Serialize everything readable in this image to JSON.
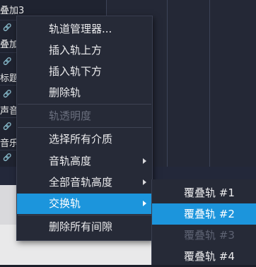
{
  "background": {
    "track_labels": [
      "叠加3",
      "叠加",
      "标题",
      "声音",
      "音乐"
    ]
  },
  "context_menu": {
    "items": [
      {
        "label": "轨道管理器...",
        "enabled": true
      },
      {
        "label": "插入轨上方",
        "enabled": true
      },
      {
        "label": "插入轨下方",
        "enabled": true
      },
      {
        "label": "删除轨",
        "enabled": true
      },
      {
        "label": "轨透明度",
        "enabled": false
      },
      {
        "label": "选择所有介质",
        "enabled": true
      },
      {
        "label": "音轨高度",
        "enabled": true,
        "submenu": true
      },
      {
        "label": "全部音轨高度",
        "enabled": true,
        "submenu": true
      },
      {
        "label": "交换轨",
        "enabled": true,
        "submenu": true,
        "active": true
      },
      {
        "label": "删除所有间隙",
        "enabled": true
      }
    ]
  },
  "swap_submenu": {
    "items": [
      {
        "label": "覆叠轨 #1",
        "enabled": true
      },
      {
        "label": "覆叠轨 #2",
        "enabled": true,
        "active": true
      },
      {
        "label": "覆叠轨 #3",
        "enabled": false
      },
      {
        "label": "覆叠轨 #4",
        "enabled": true
      }
    ]
  },
  "colors": {
    "menu_bg": "#262a37",
    "highlight": "#1c95dc",
    "disabled_text": "#6a6f7e"
  }
}
